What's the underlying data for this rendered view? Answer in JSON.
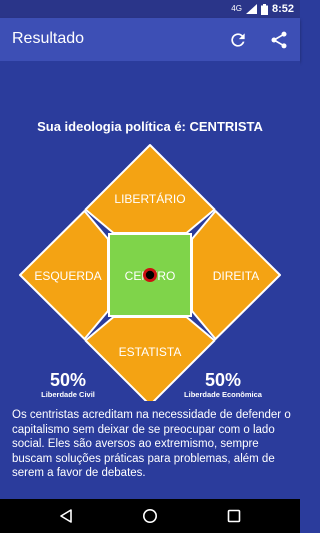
{
  "status_bar": {
    "network": "4G",
    "time": "8:52"
  },
  "app_bar": {
    "title": "Resultado",
    "refresh_icon": "refresh-icon",
    "share_icon": "share-icon"
  },
  "result": {
    "headline": "Sua ideologia política é: CENTRISTA",
    "quadrants": {
      "top": "LIBERTÁRIO",
      "left": "ESQUERDA",
      "right": "DIREITA",
      "bottom": "ESTATISTA",
      "center": "CENTRO"
    },
    "civil": {
      "value": "50%",
      "label": "Liberdade Civil",
      "fraction": 0.5
    },
    "economic": {
      "value": "50%",
      "label": "Liberdade Econômica",
      "fraction": 0.5
    },
    "description": "Os centristas acreditam na necessidade de defender o capitalismo sem deixar de se preocupar com o lado social. Eles são aversos ao extremismo, sempre buscam soluções práticas para problemas, além de serem a favor de debates."
  },
  "colors": {
    "quadrant": "#f4a313",
    "center": "#7fd44a",
    "background": "#2b3c9c",
    "app_bar": "#3d4fb5",
    "marker_ring": "#cc1111"
  },
  "nav_bar": {
    "back_icon": "back-triangle-icon",
    "home_icon": "home-circle-icon",
    "recents_icon": "recents-square-icon"
  }
}
